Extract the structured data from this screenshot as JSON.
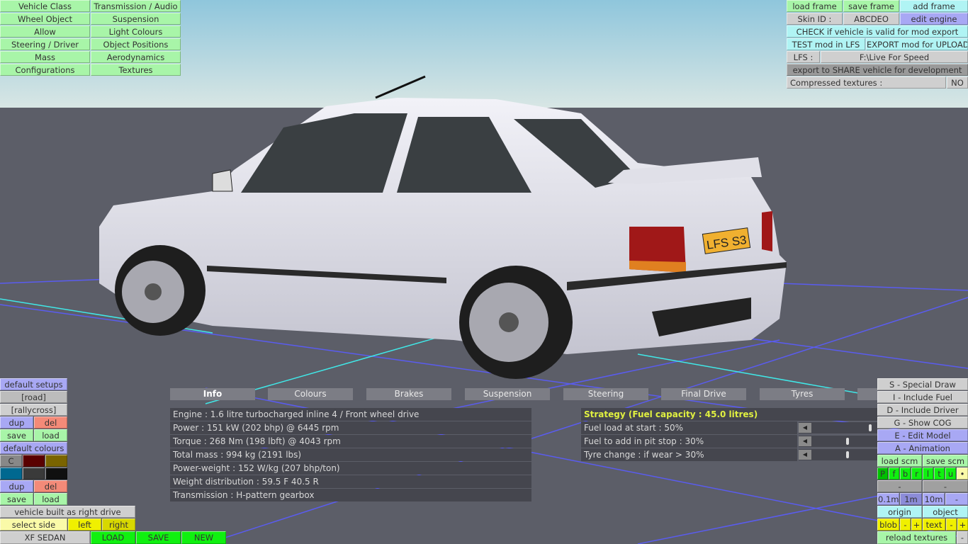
{
  "top_left_menu": [
    [
      "Vehicle Class",
      "Transmission / Audio"
    ],
    [
      "Wheel Object",
      "Suspension"
    ],
    [
      "Allow",
      "Light Colours"
    ],
    [
      "Steering / Driver",
      "Object Positions"
    ],
    [
      "Mass",
      "Aerodynamics"
    ],
    [
      "Configurations",
      "Textures"
    ]
  ],
  "top_right": {
    "load_frame": "load frame",
    "save_frame": "save frame",
    "add_frame": "add frame",
    "skin_id_label": "Skin ID :",
    "skin_id": "ABCDEO",
    "edit_engine": "edit engine",
    "check": "CHECK if vehicle is valid for mod export",
    "test": "TEST mod in LFS",
    "export": "EXPORT mod for UPLOAD",
    "lfs_label": "LFS :",
    "lfs_path": "F:\\Live For Speed",
    "share": "export to SHARE vehicle for development",
    "compressed_label": "Compressed textures :",
    "compressed_value": "NO"
  },
  "plate": "LFS S3",
  "tabs": [
    "Info",
    "Colours",
    "Brakes",
    "Suspension",
    "Steering",
    "Final Drive",
    "Tyres"
  ],
  "active_tab": "Info",
  "info_rows": [
    "Engine : 1.6 litre turbocharged inline 4 / Front wheel drive",
    "Power : 151 kW (202 bhp) @ 6445 rpm",
    "Torque : 268 Nm (198 lbft) @ 4043 rpm",
    "Total mass : 994 kg (2191 lbs)",
    "Power-weight : 152 W/kg (207 bhp/ton)",
    "Weight distribution : 59.5 F  40.5 R",
    "Transmission : H-pattern gearbox"
  ],
  "strategy": {
    "title": "Strategy (Fuel capacity : 45.0 litres)",
    "rows": [
      {
        "label": "Fuel load at start : 50%",
        "value": 50
      },
      {
        "label": "Fuel to add in pit stop : 30%",
        "value": 30
      },
      {
        "label": "Tyre change : if wear > 30%",
        "value": 30
      }
    ]
  },
  "bottom_left": {
    "default_setups": "default setups",
    "road": "[road]",
    "rallycross": "[rallycross]",
    "dup": "dup",
    "del": "del",
    "save": "save",
    "load": "load",
    "default_colours": "default colours",
    "c": "C",
    "swatches": [
      "#5a0000",
      "#7a6400",
      "#006890",
      "#3a3a3a",
      "#101010"
    ],
    "right_drive": "vehicle built as right drive",
    "select_side": "select side",
    "left": "left",
    "right": "right",
    "vehicle": "XF SEDAN",
    "load_btn": "LOAD",
    "save_btn": "SAVE",
    "new_btn": "NEW"
  },
  "bottom_right": {
    "special": "S - Special Draw",
    "fuel": "I - Include Fuel",
    "driver": "D - Include Driver",
    "cog": "G - Show COG",
    "edit_model": "E - Edit Model",
    "animation": "A - Animation",
    "load_scm": "load scm",
    "save_scm": "save scm",
    "letters": [
      "P",
      "f",
      "b",
      "r",
      "l",
      "t",
      "u"
    ],
    "dot": "•",
    "minus": "-",
    "step1": "0.1m",
    "step2": "1m",
    "step3": "10m",
    "origin": "origin",
    "object": "object",
    "blob": "blob",
    "plus": "+",
    "text": "text",
    "reload": "reload textures"
  }
}
